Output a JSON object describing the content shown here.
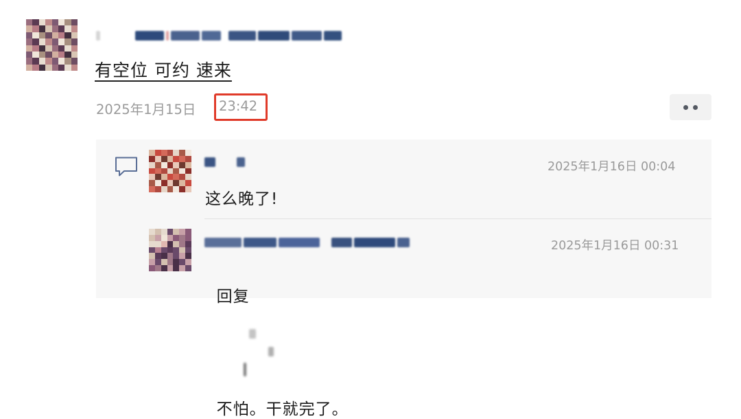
{
  "post": {
    "text": "有空位 可约 速来",
    "date": "2025年1月15日",
    "time": "23:42"
  },
  "comments": [
    {
      "date": "2025年1月16日 00:04",
      "text": "这么晚了!"
    },
    {
      "reply_prefix": "回复",
      "date": "2025年1月16日 00:31",
      "text": "不怕。干就完了。"
    }
  ],
  "icons": {
    "more": "more-dots-icon",
    "comment": "comment-bubble-icon"
  },
  "colors": {
    "highlight_box": "#e03b2a",
    "timestamp": "#9a9a9a",
    "comments_bg": "#f7f7f7"
  }
}
